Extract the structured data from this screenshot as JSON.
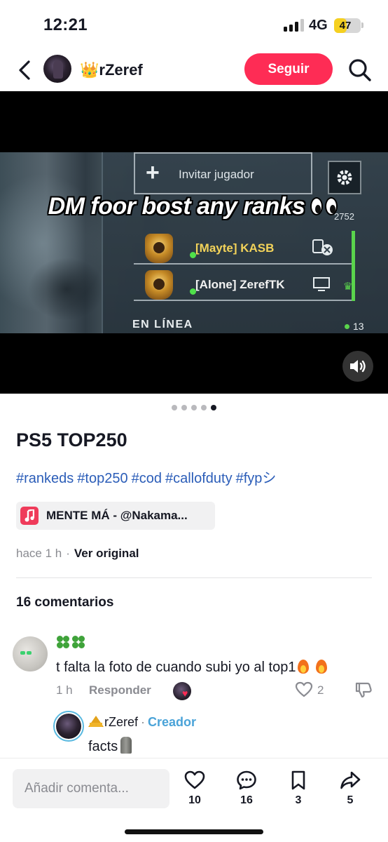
{
  "status_bar": {
    "time": "12:21",
    "network": "4G",
    "battery": "47",
    "battery_level": 0.47
  },
  "header": {
    "username": "👑rZeref",
    "follow_label": "Seguir"
  },
  "media": {
    "caption": "DM foor bost any ranks",
    "game_ui": {
      "invite_label": "Invitar jugador",
      "party_value": "2752",
      "players": [
        "[Mayte] KASB",
        "[Alone] ZerefTK"
      ],
      "online_label": "EN LÍNEA",
      "online_count": "13"
    },
    "slides_total": 5,
    "active_slide": 5
  },
  "post": {
    "title": "PS5 TOP250",
    "hashtags": [
      "#rankeds",
      "#top250",
      "#cod",
      "#callofduty",
      "#fypシ"
    ],
    "music": "MENTE MÁ - @Nakama...",
    "time": "hace 1 h",
    "separator": "·",
    "see_original": "Ver original"
  },
  "comments": {
    "count_label": "16 comentarios",
    "items": [
      {
        "user": "",
        "text": "t falta la foto de cuando subi yo al top1",
        "time": "1 h",
        "reply_label": "Responder",
        "likes": "2"
      }
    ],
    "reply": {
      "user": "rZeref",
      "separator": "·",
      "badge": "Creador",
      "text": "facts"
    }
  },
  "bottom_bar": {
    "input_placeholder": "Añadir comenta...",
    "likes": "10",
    "comments": "16",
    "saves": "3",
    "shares": "5"
  },
  "colors": {
    "brand": "#fe2c55",
    "link": "#2b5db8",
    "creator_badge": "#4aa3d8"
  }
}
